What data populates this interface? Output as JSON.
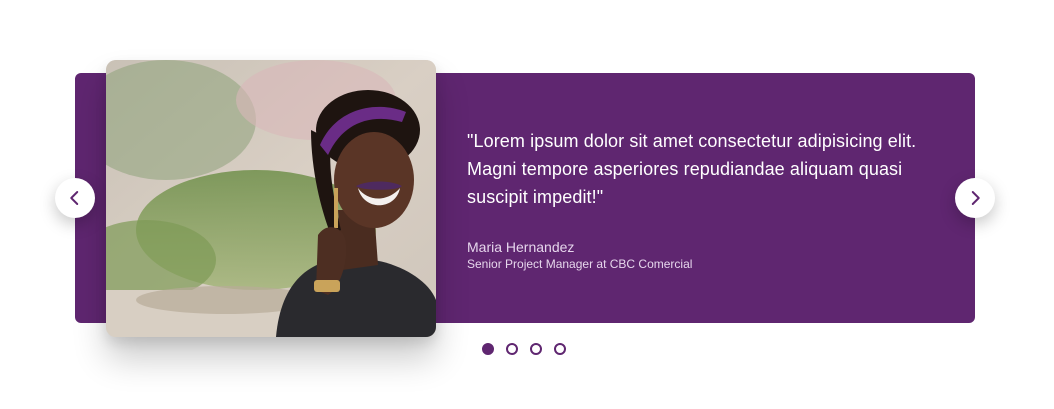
{
  "testimonial": {
    "quote": "\"Lorem ipsum dolor sit amet consectetur adipisicing elit. Magni tempore asperiores repudiandae aliquam quasi suscipit impedit!\"",
    "author_name": "Maria Hernandez",
    "author_title": "Senior Project Manager at CBC Comercial"
  },
  "navigation": {
    "prev_icon": "chevron-left-icon",
    "next_icon": "chevron-right-icon"
  },
  "pagination": {
    "total": 4,
    "active_index": 0
  },
  "colors": {
    "accent": "#5f2670",
    "card_background": "#5f2670",
    "text_primary": "#ffffff",
    "text_secondary": "#e6d6ec"
  }
}
